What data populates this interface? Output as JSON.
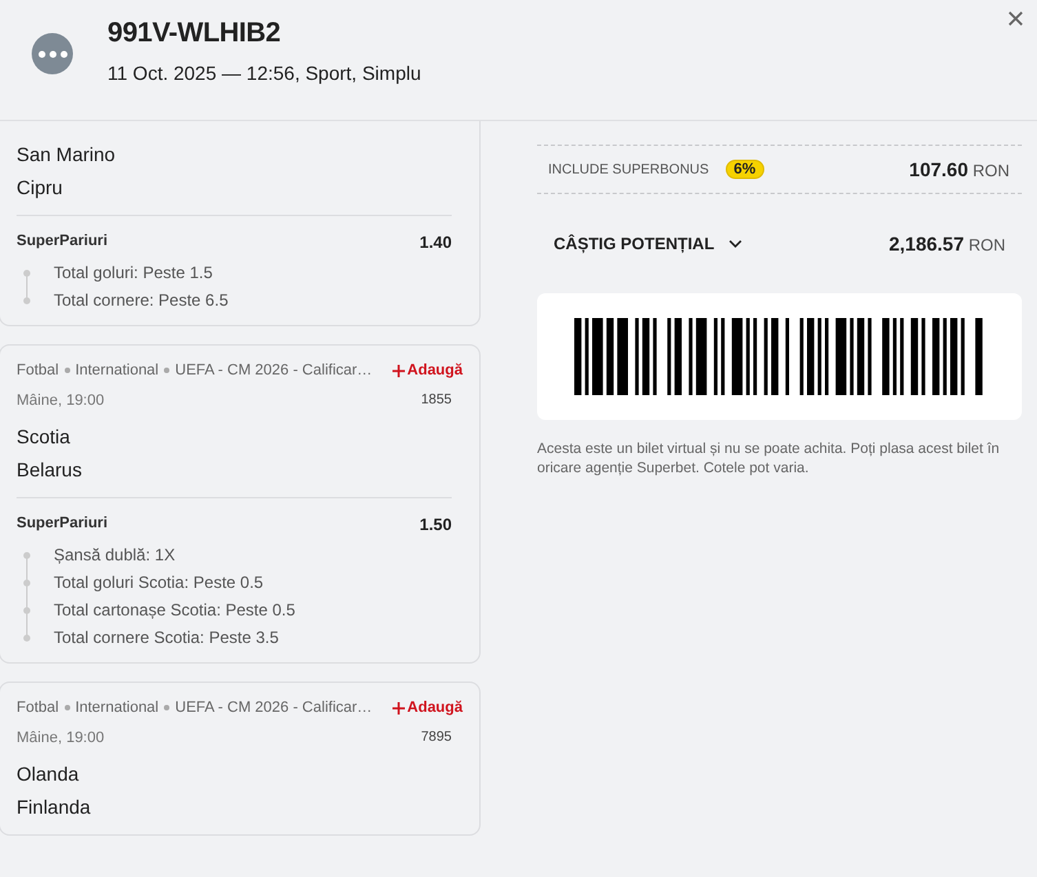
{
  "header": {
    "title": "991V-WLHIB2",
    "subtitle": "11 Oct. 2025 — 12:56, Sport, Simplu"
  },
  "events": [
    {
      "teams": [
        "San Marino",
        "Cipru"
      ],
      "bet": {
        "label": "SuperPariuri",
        "odds": "1.40",
        "selections": [
          "Total goluri: Peste 1.5",
          "Total cornere: Peste 6.5"
        ]
      }
    },
    {
      "breadcrumb": [
        "Fotbal",
        "International",
        "UEFA - CM 2026 - Calificar…"
      ],
      "add_label": "Adaugă",
      "time": "Mâine, 19:00",
      "code": "1855",
      "teams": [
        "Scotia",
        "Belarus"
      ],
      "bet": {
        "label": "SuperPariuri",
        "odds": "1.50",
        "selections": [
          "Șansă dublă: 1X",
          "Total goluri Scotia: Peste 0.5",
          "Total cartonașe Scotia: Peste 0.5",
          "Total cornere Scotia: Peste 3.5"
        ]
      }
    },
    {
      "breadcrumb": [
        "Fotbal",
        "International",
        "UEFA - CM 2026 - Calificar…"
      ],
      "add_label": "Adaugă",
      "time": "Mâine, 19:00",
      "code": "7895",
      "teams": [
        "Olanda",
        "Finlanda"
      ]
    }
  ],
  "summary": {
    "bonus_label": "INCLUDE SUPERBONUS",
    "bonus_badge": "6%",
    "bonus_amount": "107.60",
    "bonus_currency": "RON",
    "win_label": "CÂȘTIG POTENȚIAL",
    "win_amount": "2,186.57",
    "win_currency": "RON"
  },
  "disclaimer": "Acesta este un bilet virtual și nu se poate achita. Poți plasa acest bilet în oricare agenție Superbet. Cotele pot varia."
}
